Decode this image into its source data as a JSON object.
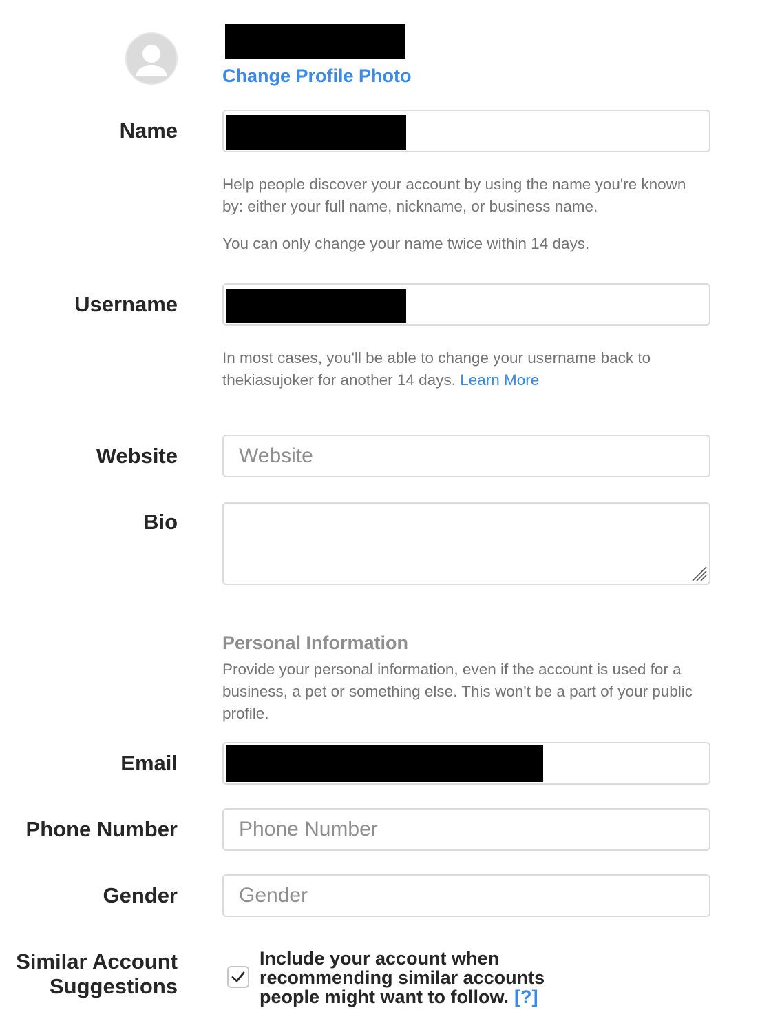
{
  "profile": {
    "change_photo_label": "Change Profile Photo"
  },
  "fields": {
    "name": {
      "label": "Name",
      "help_line_1": "Help people discover your account by using the name you're known by: either your full name, nickname, or business name.",
      "help_line_2": "You can only change your name twice within 14 days."
    },
    "username": {
      "label": "Username",
      "help_text": "In most cases, you'll be able to change your username back to thekiasujoker for another 14 days.",
      "learn_more_label": "Learn More"
    },
    "website": {
      "label": "Website",
      "placeholder": "Website"
    },
    "bio": {
      "label": "Bio"
    },
    "email": {
      "label": "Email"
    },
    "phone": {
      "label": "Phone Number",
      "placeholder": "Phone Number"
    },
    "gender": {
      "label": "Gender",
      "placeholder": "Gender"
    }
  },
  "personal_info": {
    "title": "Personal Information",
    "description": "Provide your personal information, even if the account is used for a business, a pet or something else. This won't be a part of your public profile."
  },
  "similar_accounts": {
    "label_line_1": "Similar Account",
    "label_line_2": "Suggestions",
    "checked": true,
    "description": "Include your account when recommending similar accounts people might want to follow.",
    "help_link_label": "[?]"
  },
  "colors": {
    "link_blue": "#3a8ae6",
    "border": "#dbdbdb",
    "muted_text": "#737373",
    "redaction": "#000000"
  }
}
